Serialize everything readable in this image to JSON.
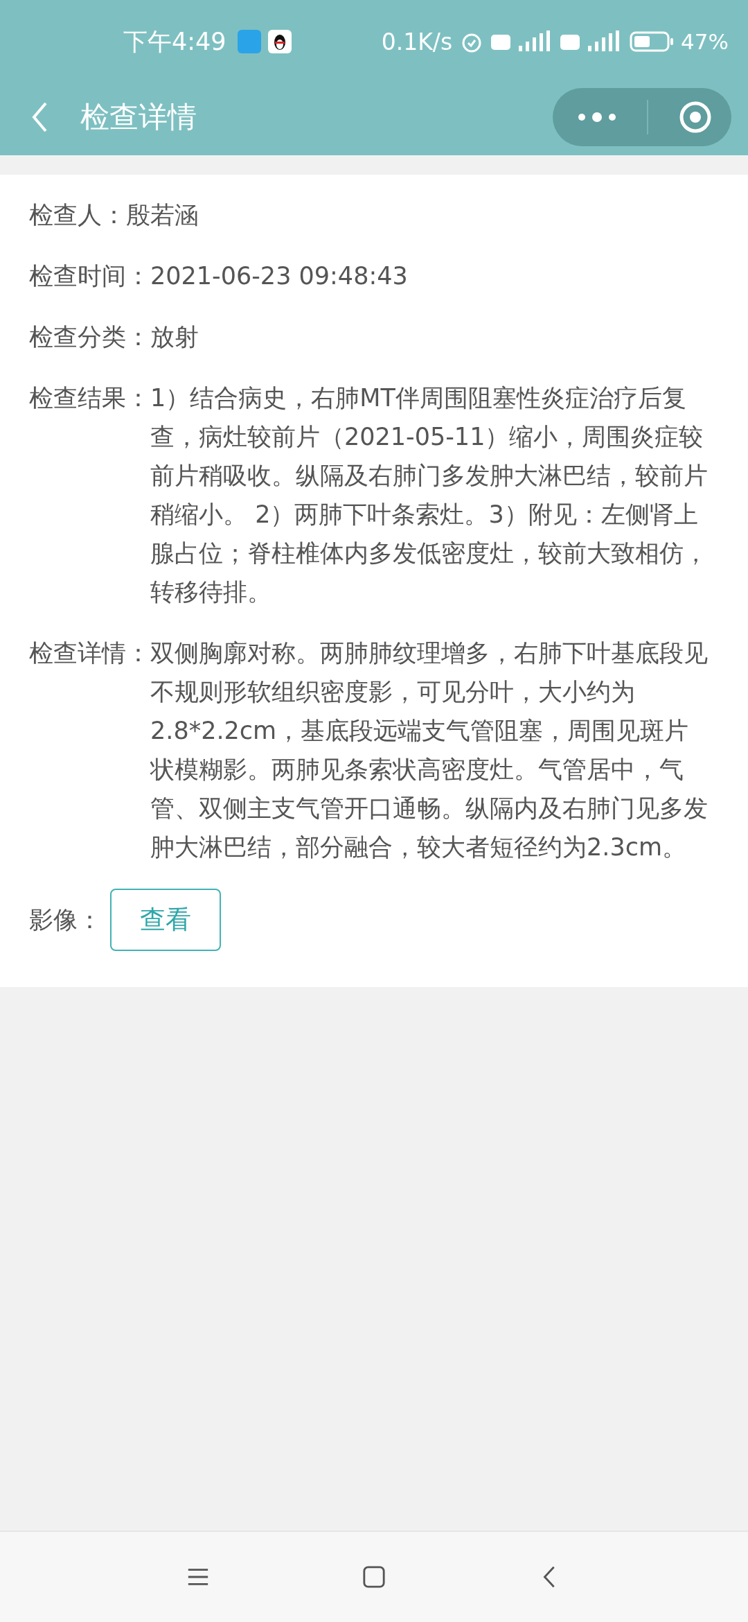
{
  "status_bar": {
    "time": "下午4:49",
    "network_speed": "0.1K/s",
    "battery": "47%"
  },
  "header": {
    "title": "检查详情"
  },
  "fields": [
    {
      "kind": "text",
      "label": "检查人：",
      "value": "殷若涵"
    },
    {
      "kind": "text",
      "label": "检查时间：",
      "value": "2021-06-23 09:48:43"
    },
    {
      "kind": "text",
      "label": "检查分类：",
      "value": "放射"
    },
    {
      "kind": "text",
      "label": "检查结果：",
      "value": "1）结合病史，右肺MT伴周围阻塞性炎症治疗后复查，病灶较前片（2021-05-11）缩小，周围炎症较前片稍吸收。纵隔及右肺门多发肿大淋巴结，较前片稍缩小。 2）两肺下叶条索灶。3）附见：左侧肾上腺占位；脊柱椎体内多发低密度灶，较前大致相仿，转移待排。"
    },
    {
      "kind": "text",
      "label": "检查详情：",
      "value": "双侧胸廓对称。两肺肺纹理增多，右肺下叶基底段见不规则形软组织密度影，可见分叶，大小约为2.8*2.2cm，基底段远端支气管阻塞，周围见斑片状模糊影。两肺见条索状高密度灶。气管居中，气管、双侧主支气管开口通畅。纵隔内及右肺门见多发肿大淋巴结，部分融合，较大者短径约为2.3cm。"
    },
    {
      "kind": "button",
      "label": "影像：",
      "button": "查看"
    }
  ]
}
